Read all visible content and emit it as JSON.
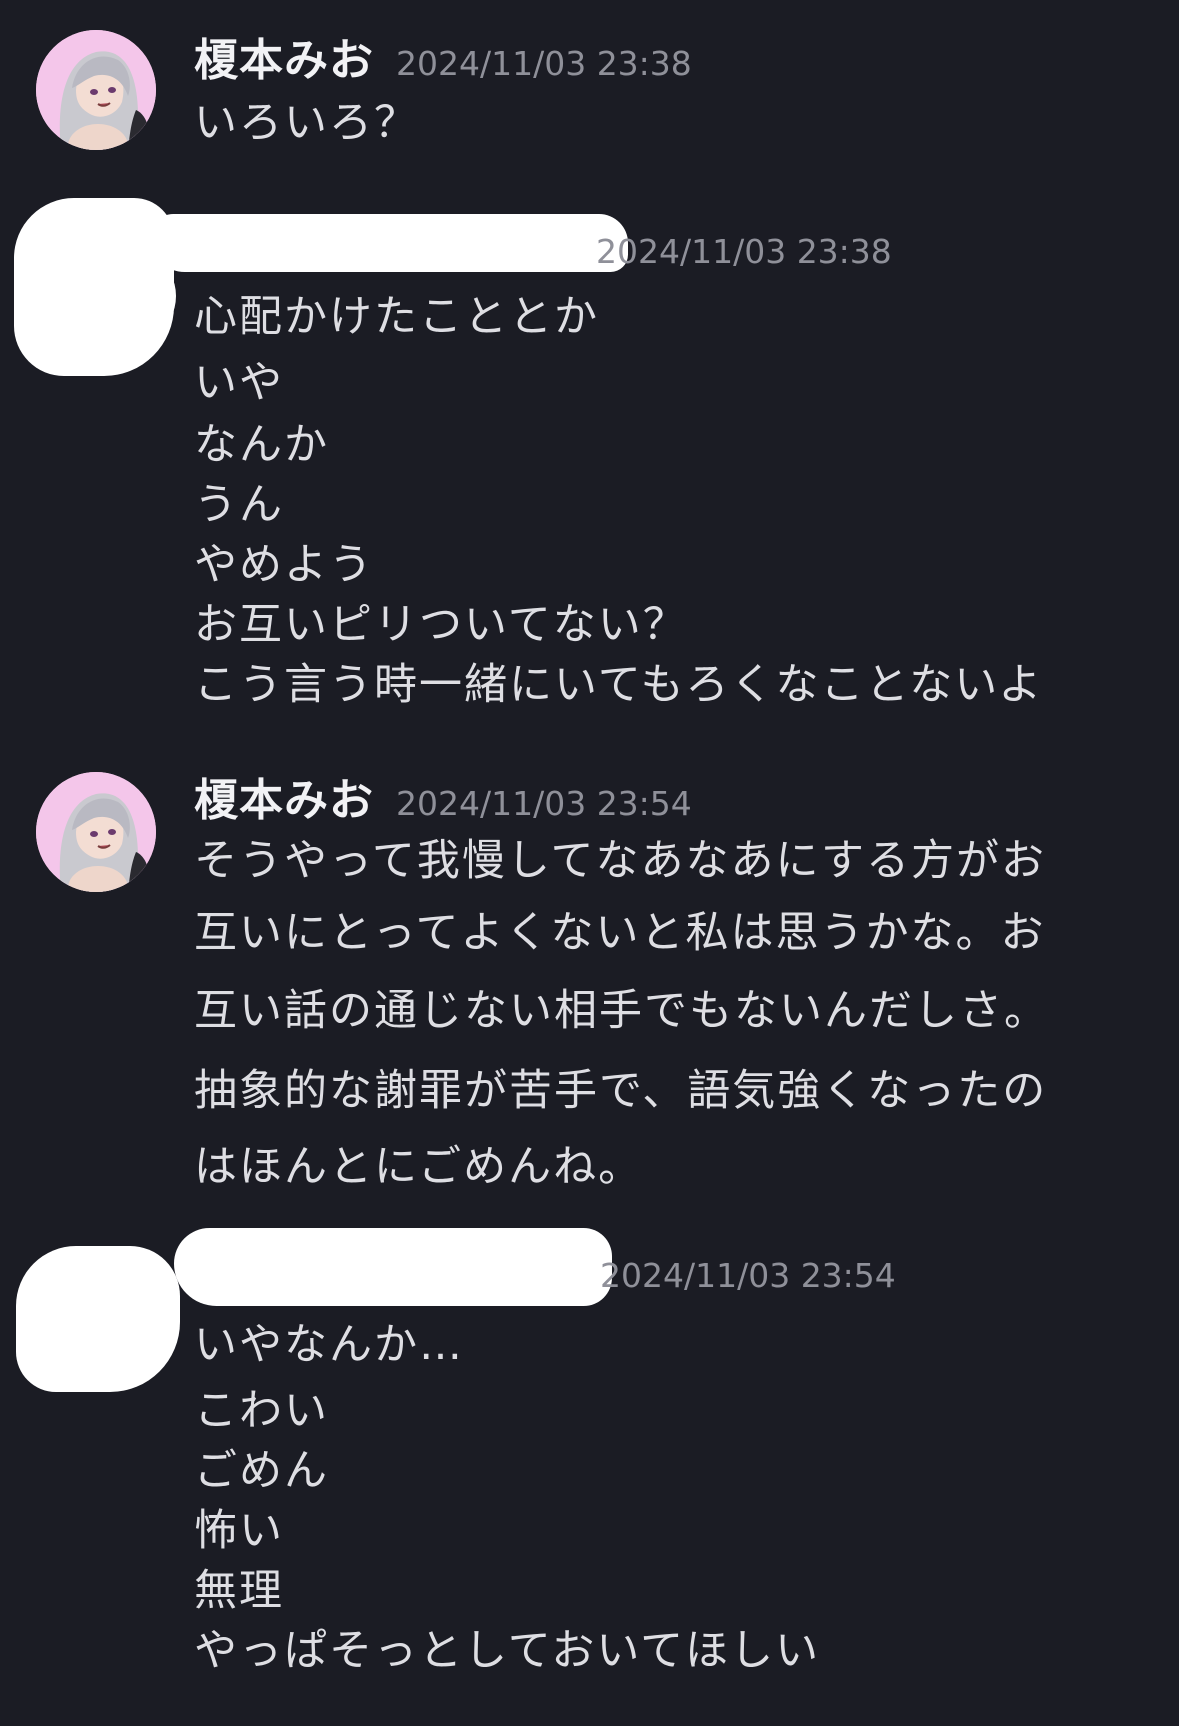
{
  "messages": [
    {
      "username": "榎本みお",
      "timestamp": "2024/11/03 23:38",
      "lines": [
        "いろいろ？"
      ],
      "avatar_icon": "anime-girl-avatar-icon"
    },
    {
      "username": "",
      "timestamp": "2024/11/03 23:38",
      "lines": [
        "心配かけたこととか",
        "いや",
        "なんか",
        "うん",
        "やめよう",
        "お互いピリついてない？",
        "こう言う時一緒にいてもろくなことないよ"
      ],
      "avatar_icon": "redacted-avatar"
    },
    {
      "username": "榎本みお",
      "timestamp": "2024/11/03 23:54",
      "lines": [
        "そうやって我慢してなあなあにする方がお",
        "互いにとってよくないと私は思うかな。お",
        "互い話の通じない相手でもないんだしさ。",
        "抽象的な謝罪が苦手で、語気強くなったの",
        "はほんとにごめんね。"
      ],
      "avatar_icon": "anime-girl-avatar-icon"
    },
    {
      "username": "",
      "timestamp": "2024/11/03 23:54",
      "lines": [
        "いやなんか…",
        "こわい",
        "ごめん",
        "怖い",
        "無理",
        "やっぱそっとしておいてほしい"
      ],
      "avatar_icon": "redacted-avatar"
    }
  ],
  "colors": {
    "background": "#1b1c24",
    "text": "#dedee3",
    "username": "#f2f2f5",
    "timestamp": "#8f9099",
    "avatar_bg": "#f2c2e6",
    "redaction": "#ffffff"
  }
}
